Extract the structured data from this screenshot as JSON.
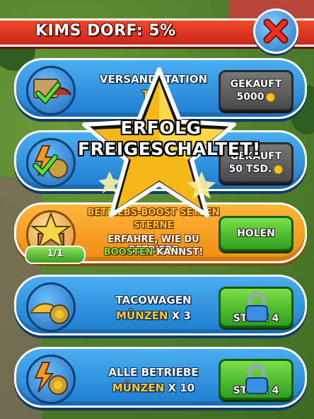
{
  "header": {
    "title": "KIMS DORF: 5%"
  },
  "achievement_popup": {
    "line1": "ERFOLG",
    "line2": "FREIGESCHALTET!"
  },
  "rows": [
    {
      "title": "VERSANDSTATION",
      "subtitle": "TEA",
      "button": {
        "line1": "GEKAUFT",
        "line2": "5000"
      }
    },
    {
      "title": "",
      "subtitle": "",
      "button": {
        "line1": "GEKAUFT",
        "line2": "50 TSD."
      }
    },
    {
      "title": "BETRIEBS-BOOST SETZEN",
      "subtitle": "STERNE",
      "desc1": "ERFAHRE, WIE DU BETRIEBE",
      "desc2_highlight": "BOOSTEN",
      "desc2_rest": "KANNST!",
      "progress": "1/1",
      "button": {
        "label": "HOLEN"
      }
    },
    {
      "title": "TACOWAGEN",
      "reward_label": "MÜNZEN",
      "reward_mult": "X 3",
      "button": {
        "label": "STUFE 4"
      }
    },
    {
      "title": "ALLE BETRIEBE",
      "reward_label": "MÜNZEN",
      "reward_mult": "X 10",
      "button": {
        "label": "STUFE 4"
      }
    }
  ],
  "colors": {
    "header_red": "#e23a20",
    "row_blue": "#2b8fe0",
    "row_orange": "#f7a020",
    "accent_gold": "#ffc526",
    "button_green": "#3cae24"
  }
}
